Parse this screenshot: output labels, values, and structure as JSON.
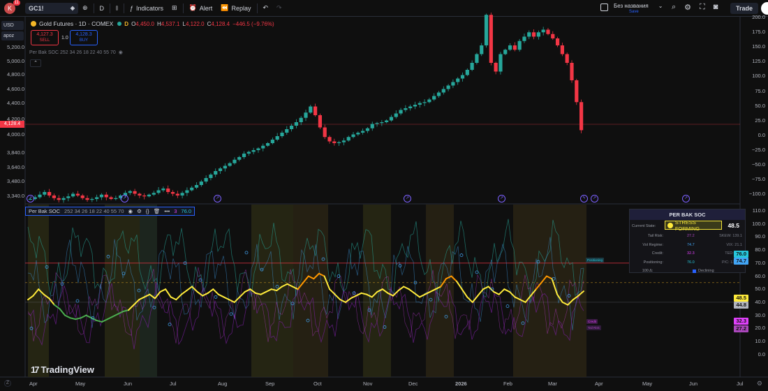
{
  "toolbar": {
    "avatar_letter": "K",
    "avatar_badge": "11",
    "symbol": "GC1!",
    "interval": "D",
    "indicators_label": "Indicators",
    "alert_label": "Alert",
    "replay_label": "Replay",
    "layout_name": "Без названия",
    "layout_sub": "Save",
    "trade_label": "Trade"
  },
  "left_controls": {
    "currency": "USD",
    "scale_mode": "apoz"
  },
  "legend": {
    "title": "Gold Futures · 1D · COMEX",
    "source_badge": "D",
    "o_label": "O",
    "o": "4,450.0",
    "h_label": "H",
    "h": "4,537.1",
    "l_label": "L",
    "l": "4,122.0",
    "c_label": "C",
    "c": "4,128.4",
    "change": "−446.5 (−9.76%)",
    "sell_price": "4,127.3",
    "sell_label": "SELL",
    "spread": "1.0",
    "buy_price": "4,128.3",
    "buy_label": "BUY",
    "indicator_line": "Per Bak SOC 252 34 26 18 22 40 55 70"
  },
  "price_axis": {
    "ticks": [
      "5,200.0",
      "5,000.0",
      "4,800.0",
      "4,600.0",
      "4,400.0",
      "4,200.0",
      "4,000.0",
      "3,840.0",
      "3,640.0",
      "3,480.0",
      "3,340.0"
    ],
    "last_price": "4,128.4"
  },
  "pct_axis": {
    "ticks": [
      "200.0",
      "175.0",
      "150.0",
      "125.0",
      "100.0",
      "75.0",
      "50.0",
      "25.0",
      "0.0",
      "−25.0",
      "−50.0",
      "−75.0",
      "−100.0"
    ]
  },
  "ind_axis": {
    "ticks": [
      "110.0",
      "100.0",
      "90.0",
      "80.0",
      "70.0",
      "60.0",
      "50.0",
      "40.0",
      "30.0",
      "20.0",
      "10.0",
      "0.0"
    ],
    "tags": [
      {
        "value": "76.0",
        "color": "#26c6da"
      },
      {
        "value": "74.7",
        "color": "#42a5f5"
      },
      {
        "value": "48.5",
        "color": "#ffeb3b"
      },
      {
        "value": "44.8",
        "color": "#b2b5be"
      },
      {
        "value": "32.3",
        "color": "#e040fb"
      },
      {
        "value": "27.2",
        "color": "#ab47bc"
      }
    ]
  },
  "ind_legend": {
    "name": "Per Bak SOC",
    "params": "252 34 26 18 22 40 55 70",
    "val_a": "3",
    "val_b": "76.0"
  },
  "dashboard": {
    "title": "PER BAK SOC",
    "state_label": "Current State:",
    "state": "STRESS FORMING",
    "score": "48.5",
    "rows": [
      {
        "label": "Tail Risk:",
        "value": "27.2",
        "extra": "SKEW: 139.1",
        "color": "#ab47bc"
      },
      {
        "label": "Vol Regime:",
        "value": "74.7",
        "extra": "VIX: 21.1",
        "color": "#42a5f5"
      },
      {
        "label": "Credit:",
        "value": "32.3",
        "extra": "TED: 0.26",
        "color": "#e040fb"
      },
      {
        "label": "Positioning:",
        "value": "76.0",
        "extra": "P/C: 1349.2",
        "color": "#26c6da"
      }
    ],
    "footer_left": "100 Δ:",
    "footer_right": "Declining"
  },
  "time_axis": {
    "labels": [
      "Apr",
      "May",
      "Jun",
      "Jul",
      "Aug",
      "Sep",
      "Oct",
      "Nov",
      "Dec",
      "2026",
      "Feb",
      "Mar",
      "Apr",
      "May",
      "Jun",
      "Jul"
    ]
  },
  "mini_tags": {
    "positioning": "Positioning",
    "credit": "Credit",
    "tail": "Tail Risk"
  },
  "branding": {
    "name": "TradingView"
  },
  "chart_data": {
    "type": "candlestick",
    "symbol": "GC1!",
    "last_close": 4128.4,
    "series_close_approx": [
      3340,
      3360,
      3390,
      3420,
      3380,
      3350,
      3330,
      3350,
      3370,
      3400,
      3380,
      3350,
      3330,
      3340,
      3360,
      3390,
      3360,
      3340,
      3350,
      3380,
      3410,
      3430,
      3400,
      3380,
      3370,
      3390,
      3410,
      3440,
      3460,
      3420,
      3400,
      3380,
      3410,
      3440,
      3470,
      3500,
      3540,
      3580,
      3620,
      3660,
      3690,
      3720,
      3750,
      3790,
      3820,
      3860,
      3880,
      3900,
      3920,
      3950,
      3980,
      4020,
      4060,
      4100,
      4140,
      4180,
      4220,
      4270,
      4330,
      4400,
      4300,
      4160,
      4050,
      4000,
      3980,
      3990,
      4010,
      4050,
      4080,
      4100,
      4120,
      4150,
      4200,
      4210,
      4220,
      4240,
      4280,
      4320,
      4360,
      4380,
      4400,
      4420,
      4440,
      4450,
      4480,
      4520,
      4560,
      4600,
      4640,
      4680,
      4720,
      4760,
      4820,
      4900,
      5000,
      5100,
      5450,
      4900,
      4800,
      5000,
      5050,
      5100,
      5050,
      5150,
      5200,
      5250,
      5200,
      5250,
      5280,
      5230,
      5180,
      5100,
      5000,
      4900,
      4700,
      4450,
      4128.4
    ],
    "indicator_composite_approx": [
      42,
      45,
      50,
      46,
      43,
      38,
      35,
      30,
      28,
      27,
      28,
      30,
      28,
      26,
      25,
      27,
      29,
      31,
      33,
      34,
      38,
      42,
      44,
      46,
      43,
      48,
      50,
      44,
      42,
      46,
      49,
      52,
      48,
      45,
      47,
      50,
      46,
      44,
      42,
      40,
      44,
      48,
      50,
      47,
      46,
      48,
      50,
      49,
      52,
      54,
      52,
      50,
      55,
      60,
      58,
      62,
      60,
      50,
      46,
      42,
      40,
      43,
      45,
      47,
      46,
      44,
      48,
      50,
      47,
      45,
      49,
      52,
      50,
      47,
      44,
      46,
      48,
      50,
      52,
      58,
      60,
      56,
      50,
      44,
      40,
      45,
      50,
      52,
      48,
      46,
      50,
      48,
      44,
      42,
      40,
      45,
      50,
      55,
      60,
      58,
      46,
      40,
      38,
      42,
      45,
      48.5
    ]
  }
}
